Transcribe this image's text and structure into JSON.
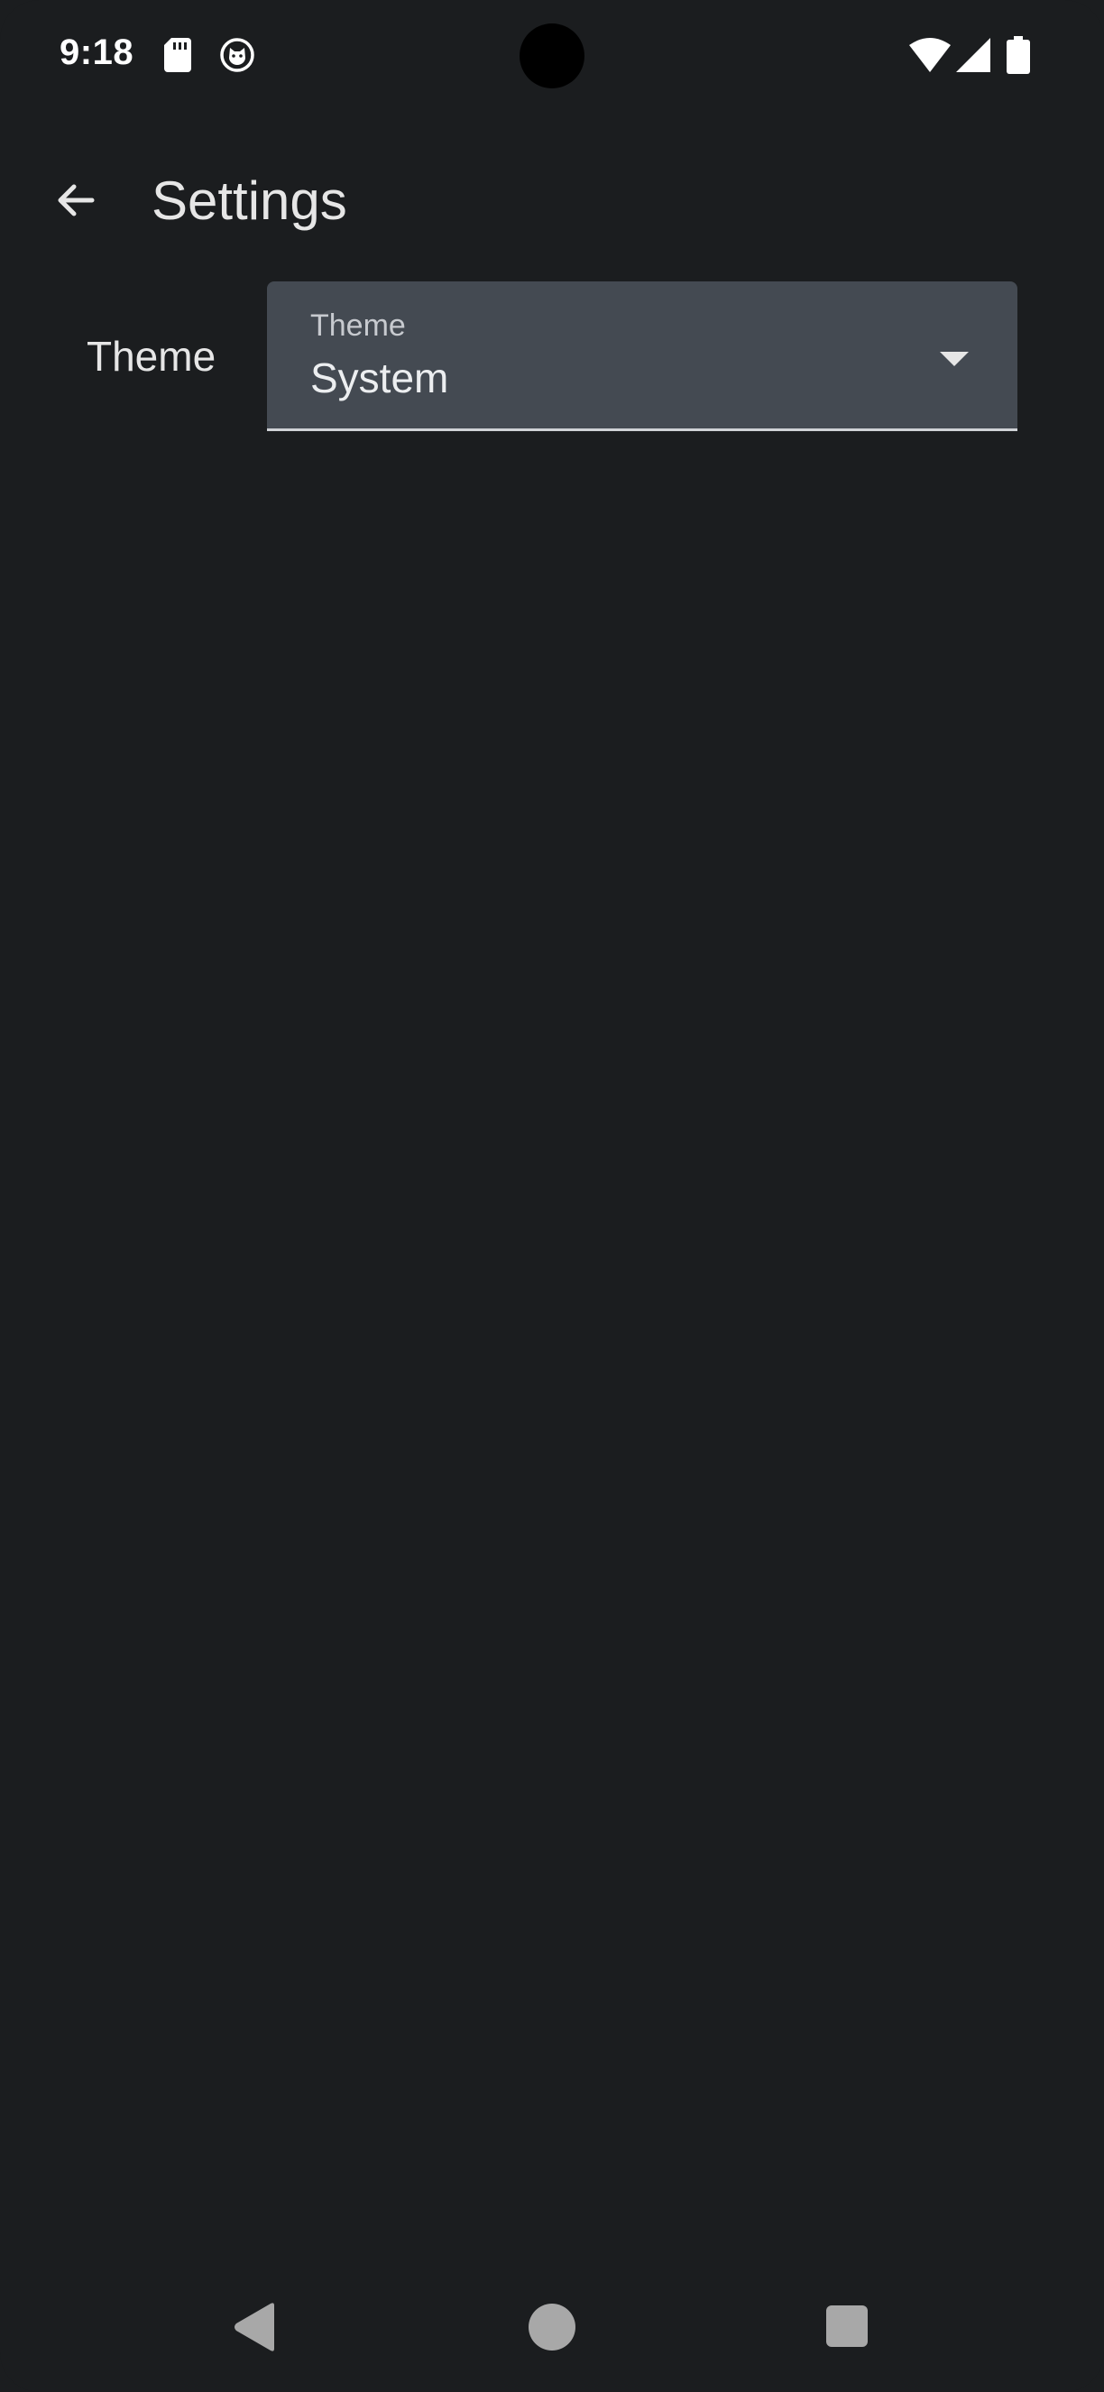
{
  "status_bar": {
    "time": "9:18",
    "icons": [
      "sd-card-icon",
      "cat-notification-icon",
      "wifi-icon",
      "cell-signal-icon",
      "battery-icon"
    ]
  },
  "app_bar": {
    "back_icon": "arrow-back-icon",
    "title": "Settings"
  },
  "theme_setting": {
    "row_label": "Theme",
    "field_label": "Theme",
    "selected_value": "System",
    "dropdown_icon": "dropdown-arrow-icon"
  },
  "nav_bar": {
    "icons": [
      "nav-back-icon",
      "nav-home-icon",
      "nav-recents-icon"
    ]
  },
  "colors": {
    "background": "#1b1d1f",
    "field_fill": "#444a52",
    "field_underline": "#cfd2d6",
    "text_primary": "#e6e6e6",
    "nav_icon": "#a8a8a8"
  }
}
